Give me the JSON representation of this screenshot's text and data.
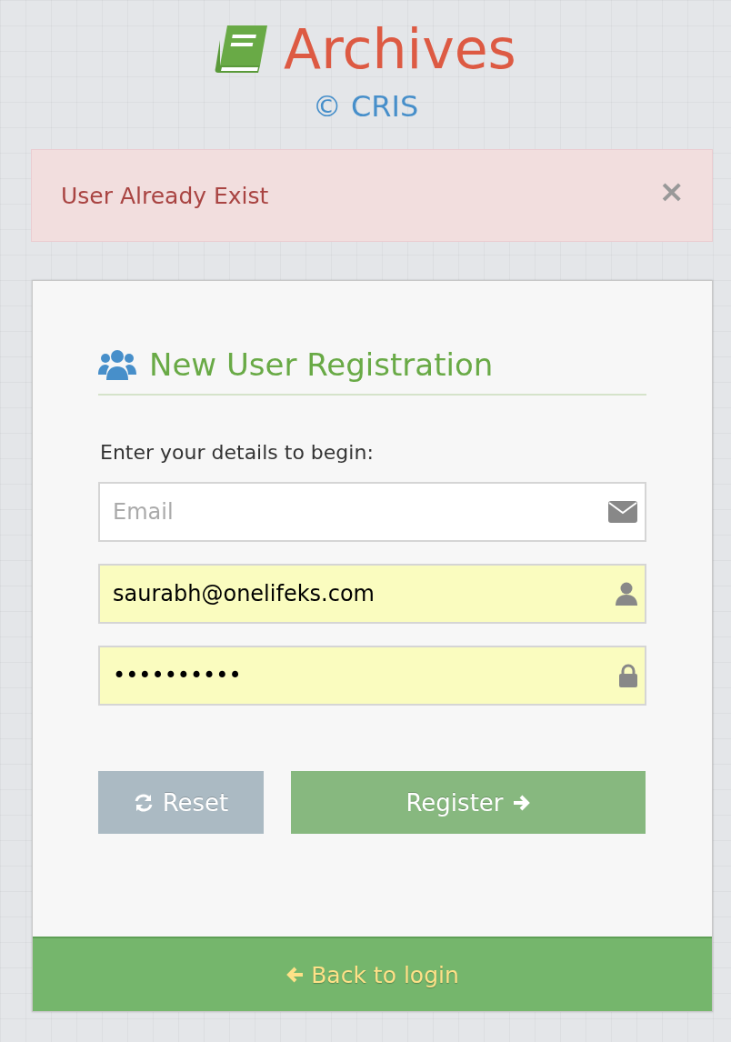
{
  "header": {
    "title": "Archives",
    "subtitle": "© CRIS"
  },
  "alert": {
    "message": "User Already Exist",
    "close": "×"
  },
  "form": {
    "heading": "New User Registration",
    "instructions": "Enter your details to begin:",
    "fields": [
      {
        "kind": "email",
        "placeholder": "Email",
        "autofilled": false
      },
      {
        "kind": "user",
        "value": "saurabh@onelifeks.com",
        "autofilled": true
      },
      {
        "kind": "password",
        "value": "••••••••••",
        "autofilled": true
      }
    ],
    "buttons": [
      {
        "kind": "reset",
        "label": "Reset"
      },
      {
        "kind": "register",
        "label": "Register"
      }
    ]
  },
  "footer": {
    "link": "Back to login"
  }
}
